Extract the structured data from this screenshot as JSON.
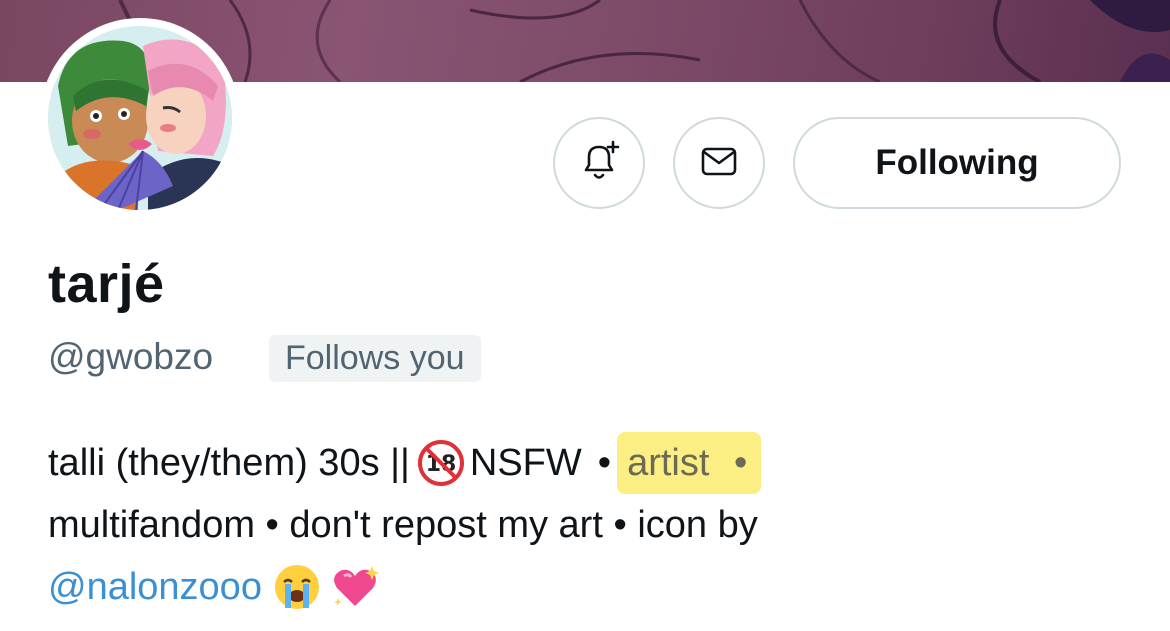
{
  "profile": {
    "display_name": "tarjé",
    "handle": "@gwobzo",
    "follows_you_badge": "Follows you"
  },
  "actions": {
    "notify_icon": "bell-plus-icon",
    "message_icon": "envelope-icon",
    "following_label": "Following"
  },
  "bio": {
    "line1_prefix": "talli (they/them) 30s ||",
    "line1_nsfw": "NSFW",
    "line1_sep": "•",
    "line1_highlighted": "artist",
    "line1_highlight_sep": "•",
    "line2": "multifandom • don't repost my art • icon by",
    "mention": "@nalonzooo",
    "emojis": [
      "loudly-crying-face-emoji",
      "sparkling-heart-emoji"
    ],
    "nsfw_emoji": "no-one-under-eighteen-emoji"
  },
  "colors": {
    "mention": "#3b8fd3",
    "highlight": "#fae85a",
    "muted": "#536471",
    "border": "#cfd9de"
  }
}
